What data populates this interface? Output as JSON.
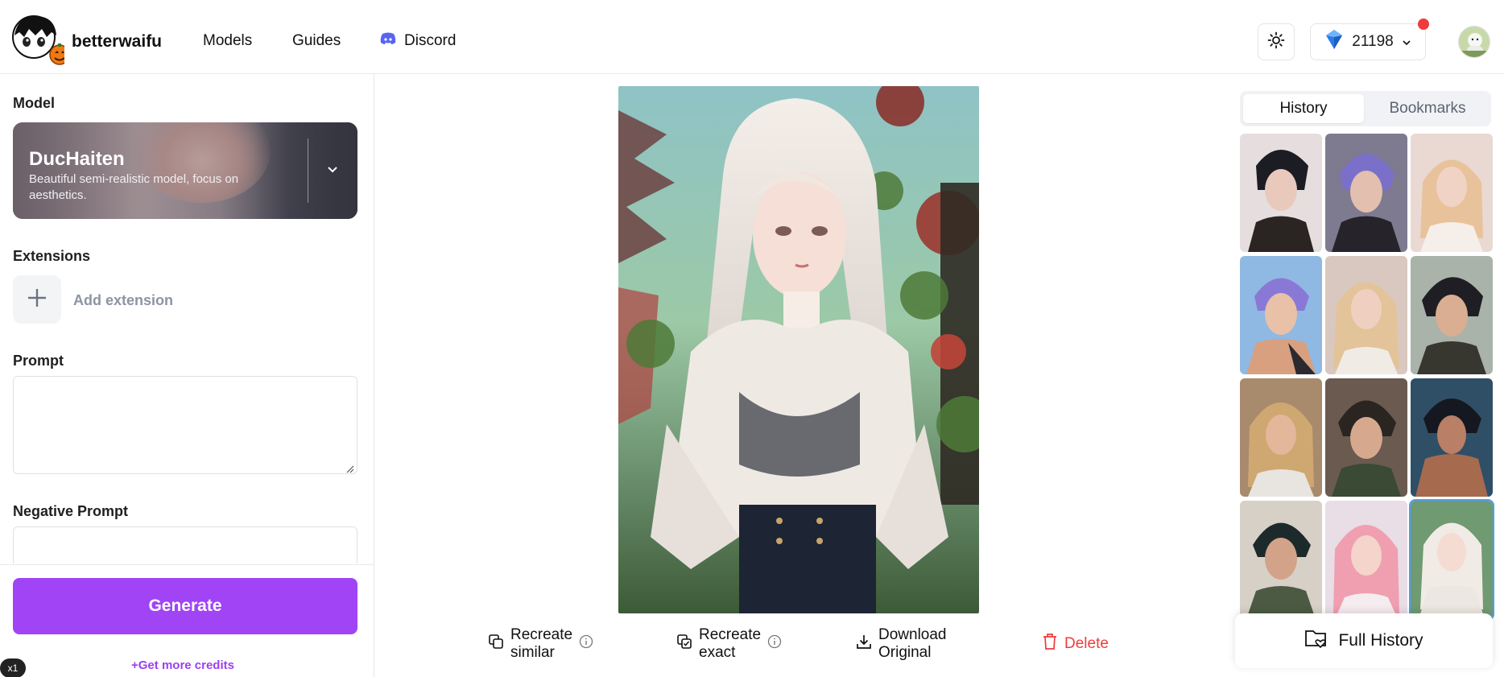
{
  "header": {
    "brand": "betterwaifu",
    "nav": {
      "models": "Models",
      "guides": "Guides",
      "discord": "Discord"
    },
    "credits": "21198",
    "icons": {
      "theme": "sun-icon",
      "credits": "gem-icon",
      "discord": "discord-icon"
    }
  },
  "left": {
    "model_label": "Model",
    "model": {
      "name": "DucHaiten",
      "description": "Beautiful semi-realistic model, focus on aesthetics."
    },
    "extensions_label": "Extensions",
    "add_extension": "Add extension",
    "prompt_label": "Prompt",
    "prompt_value": "",
    "negative_prompt_label": "Negative Prompt",
    "negative_prompt_value": "",
    "generate": "Generate",
    "get_more_credits": "Get more credits",
    "zoom_badge": "x1"
  },
  "center": {
    "actions": {
      "recreate_similar": "Recreate similar",
      "recreate_exact": "Recreate exact",
      "download": "Download Original",
      "delete": "Delete"
    }
  },
  "right": {
    "tabs": {
      "history": "History",
      "bookmarks": "Bookmarks"
    },
    "full_history": "Full History"
  },
  "colors": {
    "accent": "#a044f5",
    "danger": "#ef3b3b",
    "selected_outline": "#4f9cf3"
  }
}
